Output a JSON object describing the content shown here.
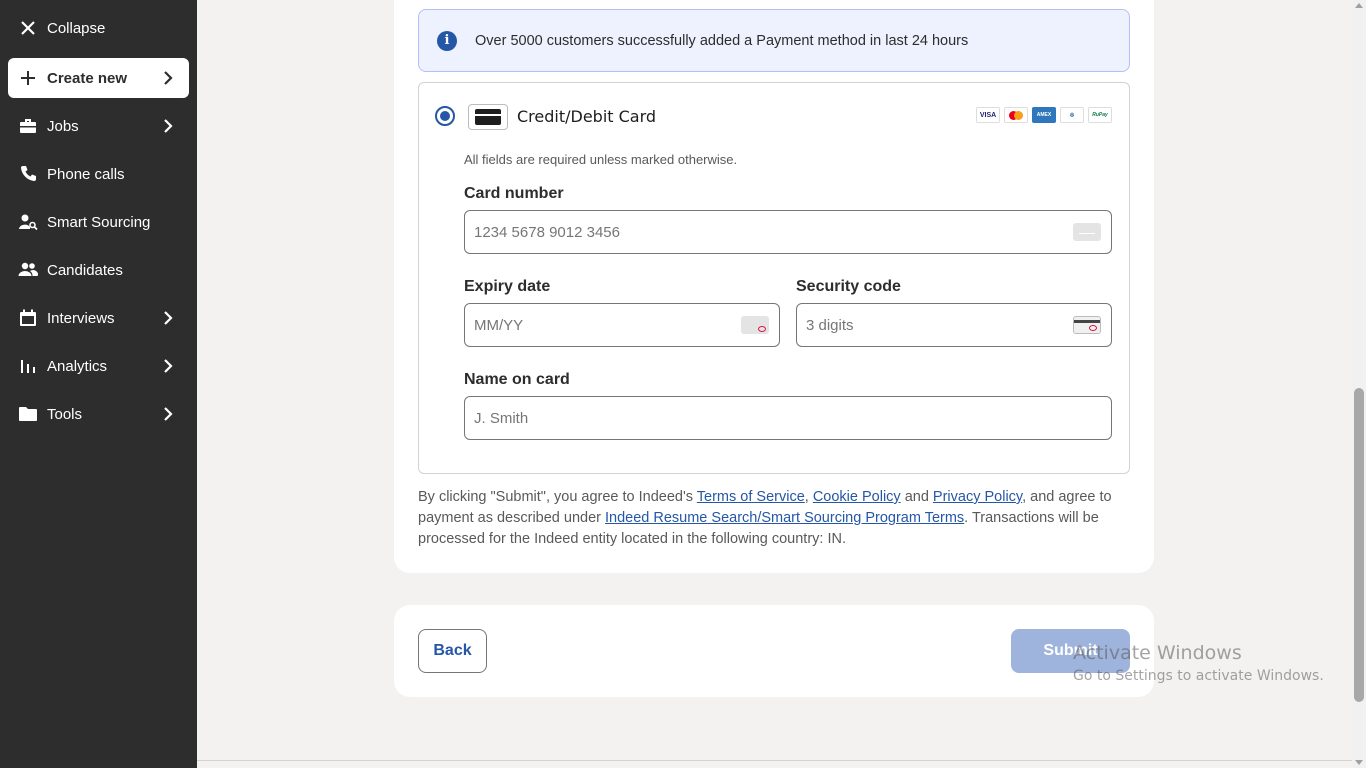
{
  "sidebar": {
    "collapse_label": "Collapse",
    "items": [
      {
        "label": "Create new",
        "icon": "plus-icon"
      },
      {
        "label": "Jobs",
        "icon": "briefcase-icon"
      },
      {
        "label": "Phone calls",
        "icon": "phone-icon"
      },
      {
        "label": "Smart Sourcing",
        "icon": "person-search-icon"
      },
      {
        "label": "Candidates",
        "icon": "people-icon"
      },
      {
        "label": "Interviews",
        "icon": "calendar-icon"
      },
      {
        "label": "Analytics",
        "icon": "bar-chart-icon"
      },
      {
        "label": "Tools",
        "icon": "folder-icon"
      }
    ]
  },
  "banner": {
    "text": "Over 5000 customers successfully added a Payment method in last 24 hours"
  },
  "payment": {
    "method_title": "Credit/Debit Card",
    "brands": [
      "VISA",
      "Mastercard",
      "AMEX",
      "Diners",
      "RuPay"
    ],
    "helper": "All fields are required unless marked otherwise.",
    "card_number_label": "Card number",
    "card_number_placeholder": "1234 5678 9012 3456",
    "expiry_label": "Expiry date",
    "expiry_placeholder": "MM/YY",
    "security_label": "Security code",
    "security_placeholder": "3 digits",
    "name_label": "Name on card",
    "name_placeholder": "J. Smith"
  },
  "legal": {
    "p1": "By clicking \"Submit\", you agree to Indeed's ",
    "terms": "Terms of Service",
    "comma": ", ",
    "cookie": "Cookie Policy",
    "and": " and ",
    "privacy": "Privacy Policy",
    "p2": ", and agree to payment as described under ",
    "program": "Indeed Resume Search/Smart Sourcing Program Terms",
    "p3": ". Transactions will be processed for the Indeed entity located in the following country: IN."
  },
  "actions": {
    "back": "Back",
    "submit": "Submit"
  },
  "watermark": {
    "line1": "Activate Windows",
    "line2": "Go to Settings to activate Windows."
  },
  "colors": {
    "sidebar_bg": "#2d2d2d",
    "accent": "#2557a7",
    "submit_disabled": "#9fb4dc"
  }
}
